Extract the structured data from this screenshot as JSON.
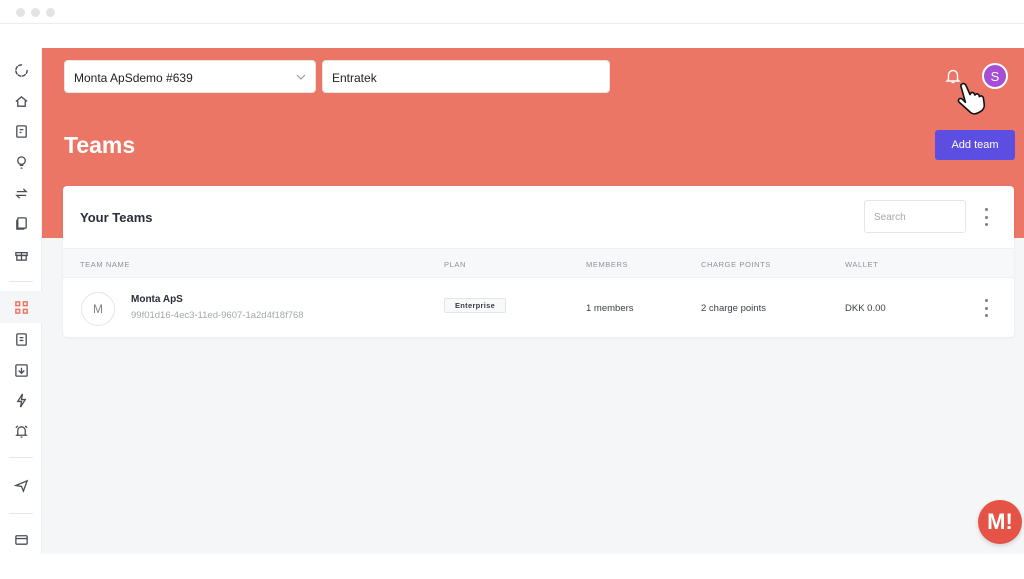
{
  "header": {
    "org_select": "Monta ApSdemo #639",
    "company_field": "Entratek",
    "user_initial": "S"
  },
  "page": {
    "title": "Teams",
    "add_button": "Add team"
  },
  "card": {
    "title": "Your Teams",
    "search_placeholder": "Search",
    "columns": [
      "TEAM NAME",
      "PLAN",
      "MEMBERS",
      "CHARGE POINTS",
      "WALLET"
    ],
    "rows": [
      {
        "avatar_initial": "M",
        "name": "Monta ApS",
        "id": "99f01d16-4ec3-11ed-9607-1a2d4f18f768",
        "plan": "Enterprise",
        "members": "1 members",
        "charge_points": "2 charge points",
        "wallet": "DKK 0.00"
      }
    ]
  },
  "brand_button": "M!",
  "sidebar": {
    "icons": [
      "loading-icon",
      "home-icon",
      "id-card-icon",
      "lightbulb-icon",
      "transfer-icon",
      "documents-icon",
      "gift-icon",
      "grid-icon",
      "badge-icon",
      "download-icon",
      "bolt-icon",
      "alarm-icon",
      "send-icon",
      "card-icon"
    ]
  },
  "colors": {
    "banner": "#ec7665",
    "primary_button": "#5b4ee0",
    "avatar": "#a64ed5",
    "brand": "#e45345"
  }
}
